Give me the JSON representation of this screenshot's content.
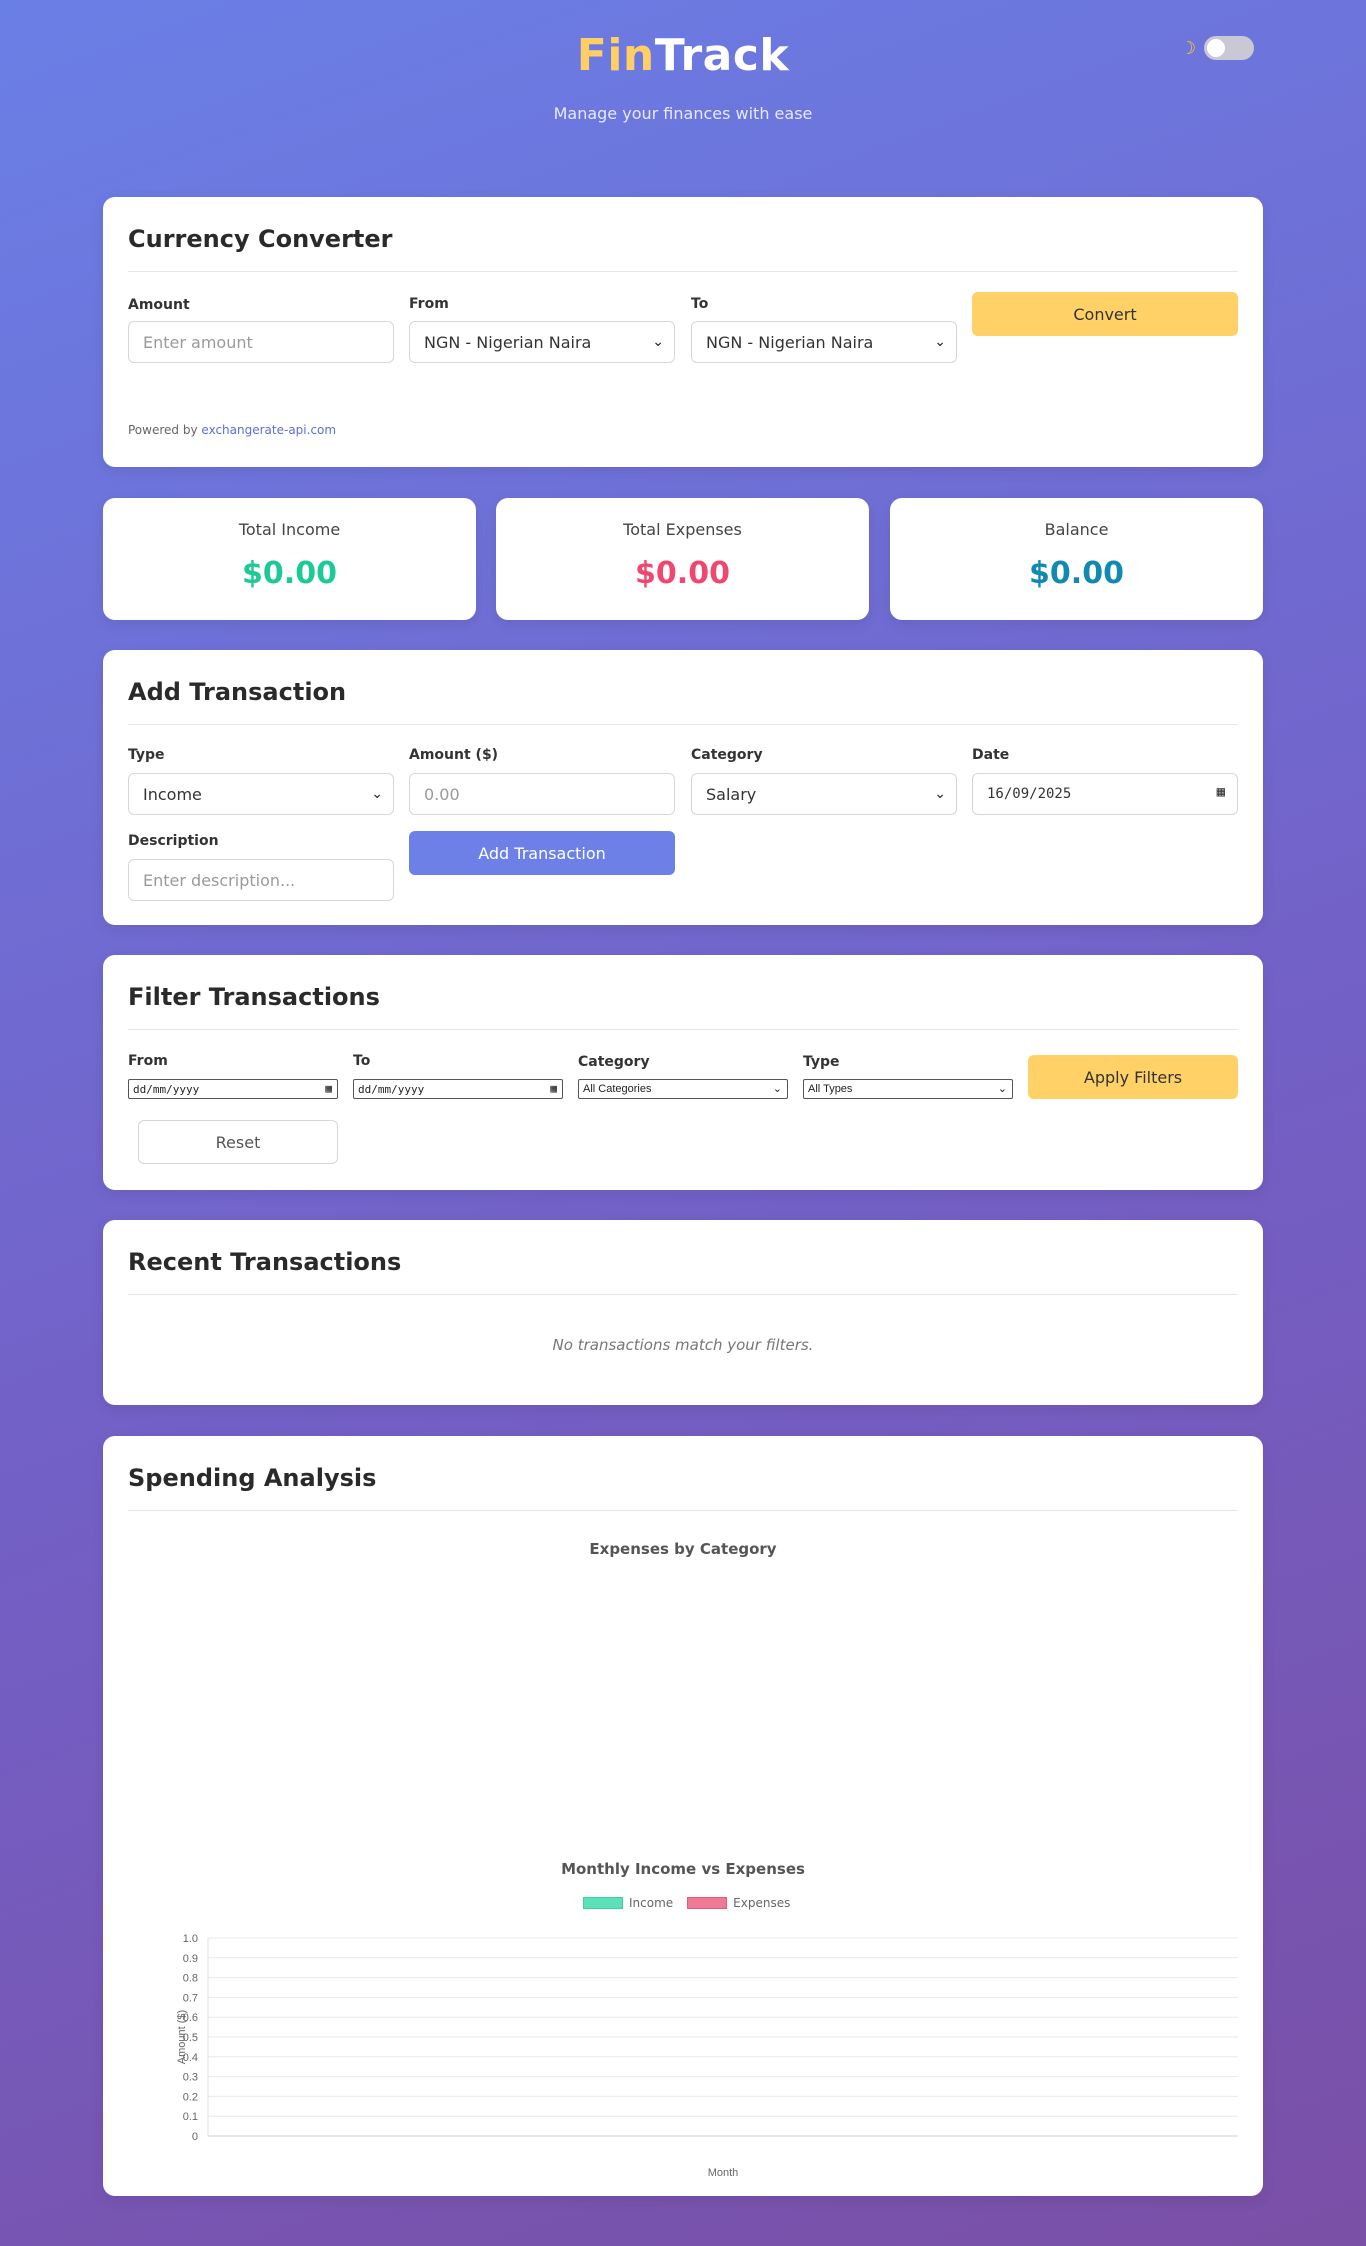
{
  "header": {
    "brand_part1": "Fin",
    "brand_part2": "Track",
    "tagline": "Manage your finances with ease",
    "theme_icon": "moon-icon",
    "dark_mode_enabled": false
  },
  "converter": {
    "title": "Currency Converter",
    "amount_label": "Amount",
    "amount_placeholder": "Enter amount",
    "from_label": "From",
    "from_value": "NGN - Nigerian Naira",
    "to_label": "To",
    "to_value": "NGN - Nigerian Naira",
    "convert_label": "Convert",
    "powered_by": "Powered by",
    "powered_link": "exchangerate-api.com"
  },
  "stats": {
    "income_label": "Total Income",
    "income_value": "$0.00",
    "expenses_label": "Total Expenses",
    "expenses_value": "$0.00",
    "balance_label": "Balance",
    "balance_value": "$0.00",
    "income_color": "#1dc996",
    "expenses_color": "#ef476f",
    "balance_color": "#118ab2"
  },
  "add_transaction": {
    "title": "Add Transaction",
    "type_label": "Type",
    "type_value": "Income",
    "amount_label": "Amount ($)",
    "amount_placeholder": "0.00",
    "category_label": "Category",
    "category_value": "Salary",
    "date_label": "Date",
    "date_value": "16/09/2025",
    "description_label": "Description",
    "description_placeholder": "Enter description...",
    "submit_label": "Add Transaction"
  },
  "filter": {
    "title": "Filter Transactions",
    "from_label": "From",
    "from_value": "dd/mm/yyyy",
    "to_label": "To",
    "to_value": "dd/mm/yyyy",
    "category_label": "Category",
    "category_value": "All Categories",
    "type_label": "Type",
    "type_value": "All Types",
    "apply_label": "Apply Filters",
    "reset_label": "Reset"
  },
  "recent": {
    "title": "Recent Transactions",
    "empty_message": "No transactions match your filters."
  },
  "analysis": {
    "title": "Spending Analysis",
    "pie_title": "Expenses by Category"
  },
  "chart_data": {
    "type": "bar",
    "title": "Monthly Income vs Expenses",
    "xlabel": "Month",
    "ylabel": "Amount ($)",
    "ylim": [
      0,
      1.0
    ],
    "yticks": [
      "1.0",
      "0.9",
      "0.8",
      "0.7",
      "0.6",
      "0.5",
      "0.4",
      "0.3",
      "0.2",
      "0.1",
      "0"
    ],
    "categories": [],
    "series": [
      {
        "name": "Income",
        "values": [],
        "color": "#5ce0b8"
      },
      {
        "name": "Expenses",
        "values": [],
        "color": "#f07a96"
      }
    ],
    "grid": true,
    "legend": "top-center"
  }
}
